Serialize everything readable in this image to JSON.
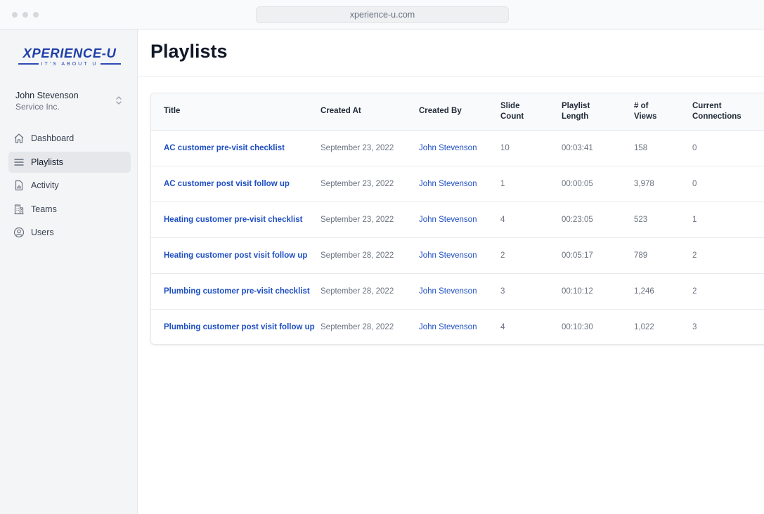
{
  "browser": {
    "url": "xperience-u.com"
  },
  "brand": {
    "name": "XPERIENCE-U",
    "tagline": "IT'S ABOUT U",
    "color": "#1f3fa8"
  },
  "account": {
    "name": "John Stevenson",
    "organization": "Service Inc."
  },
  "sidebar": {
    "items": [
      {
        "label": "Dashboard",
        "icon": "home-icon",
        "active": false
      },
      {
        "label": "Playlists",
        "icon": "list-icon",
        "active": true
      },
      {
        "label": "Activity",
        "icon": "document-chart-icon",
        "active": false
      },
      {
        "label": "Teams",
        "icon": "building-icon",
        "active": false
      },
      {
        "label": "Users",
        "icon": "user-circle-icon",
        "active": false
      }
    ]
  },
  "page": {
    "title": "Playlists"
  },
  "table": {
    "columns": [
      "Title",
      "Created At",
      "Created By",
      "Slide Count",
      "Playlist Length",
      "# of Views",
      "Current Connections"
    ],
    "rows": [
      {
        "title": "AC customer pre-visit checklist",
        "created_at": "September 23, 2022",
        "created_by": "John Stevenson",
        "slide_count": "10",
        "length": "00:03:41",
        "views": "158",
        "connections": "0"
      },
      {
        "title": "AC customer post visit follow up",
        "created_at": "September 23, 2022",
        "created_by": "John Stevenson",
        "slide_count": "1",
        "length": "00:00:05",
        "views": "3,978",
        "connections": "0"
      },
      {
        "title": "Heating customer pre-visit checklist",
        "created_at": "September 23, 2022",
        "created_by": "John Stevenson",
        "slide_count": "4",
        "length": "00:23:05",
        "views": "523",
        "connections": "1"
      },
      {
        "title": "Heating customer post visit follow up",
        "created_at": "September 28, 2022",
        "created_by": "John Stevenson",
        "slide_count": "2",
        "length": "00:05:17",
        "views": "789",
        "connections": "2"
      },
      {
        "title": "Plumbing customer pre-visit checklist",
        "created_at": "September 28, 2022",
        "created_by": "John Stevenson",
        "slide_count": "3",
        "length": "00:10:12",
        "views": "1,246",
        "connections": "2"
      },
      {
        "title": "Plumbing customer post visit follow up",
        "created_at": "September 28, 2022",
        "created_by": "John Stevenson",
        "slide_count": "4",
        "length": "00:10:30",
        "views": "1,022",
        "connections": "3"
      }
    ]
  },
  "colors": {
    "link": "#1e4fc2",
    "sidebar_bg": "#f4f5f7",
    "active_item_bg": "#e5e7eb"
  }
}
